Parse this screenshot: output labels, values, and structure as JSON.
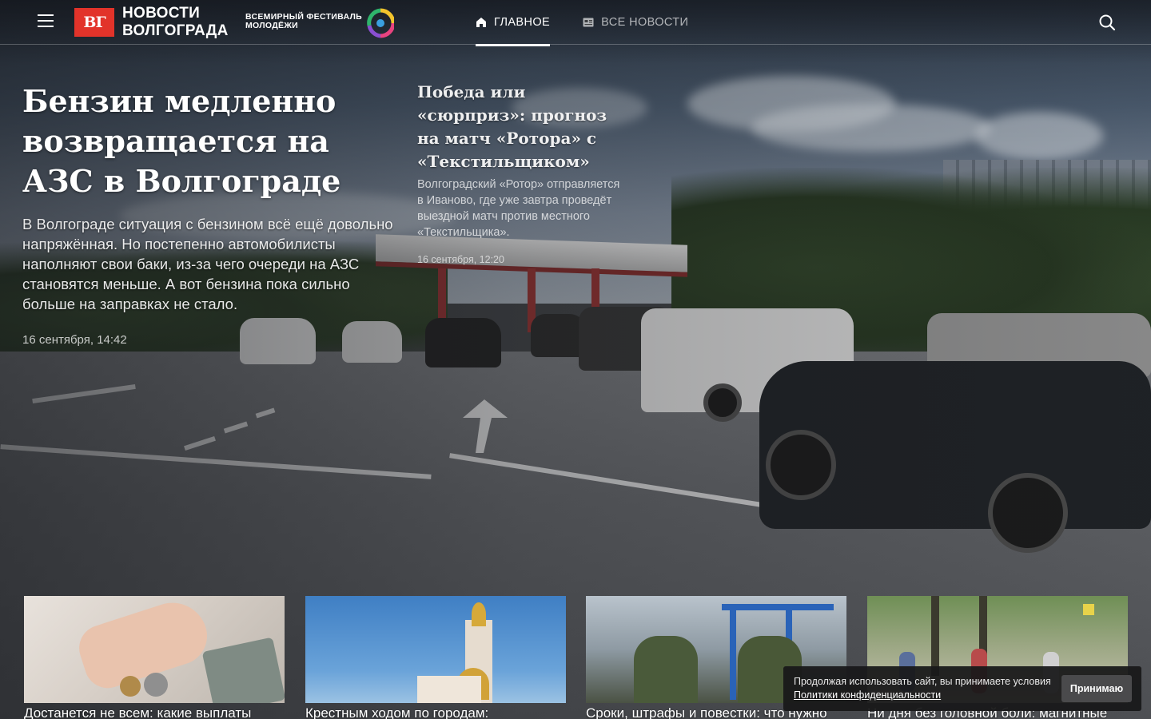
{
  "header": {
    "logo_mark": "ВГ",
    "logo_line1": "НОВОСТИ",
    "logo_line2": "ВОЛГОГРАДА",
    "festival_line1": "ВСЕМИРНЫЙ ФЕСТИВАЛЬ",
    "festival_line2": "МОЛОДЁЖИ",
    "nav": [
      {
        "label": "ГЛАВНОЕ",
        "icon": "home-icon",
        "active": true
      },
      {
        "label": "ВСЕ НОВОСТИ",
        "icon": "news-list-icon",
        "active": false
      }
    ]
  },
  "hero": {
    "main": {
      "title": "Бензин медленно возвращается на АЗС в Волгограде",
      "lead": "В Волгограде ситуация с бензином всё ещё довольно напряжённая. Но постепенно автомобилисты наполняют свои баки, из-за чего очереди на АЗС становятся меньше. А вот бензина пока сильно больше на заправках не стало.",
      "date": "16 сентября, 14:42"
    },
    "secondary": {
      "title": "Победа или «сюрприз»: прогноз на матч «Ротора» с «Текстильщиком»",
      "lead": "Волгоградский «Ротор» отправляется в Иваново, где уже завтра проведёт выездной матч против местного «Текстильщика».",
      "date": "16 сентября, 12:20"
    }
  },
  "cards": [
    {
      "title": "Достанется не всем: какие выплаты"
    },
    {
      "title": "Крестным ходом по городам:"
    },
    {
      "title": "Сроки, штрафы и повестки: что нужно"
    },
    {
      "title": "Ни дня без головной боли: магнитные"
    }
  ],
  "cookie": {
    "text": "Продолжая использовать сайт, вы принимаете условия",
    "link": "Политики конфиденциальности",
    "button": "Принимаю"
  },
  "colors": {
    "brand_red": "#e2332a",
    "text": "#ffffff"
  }
}
